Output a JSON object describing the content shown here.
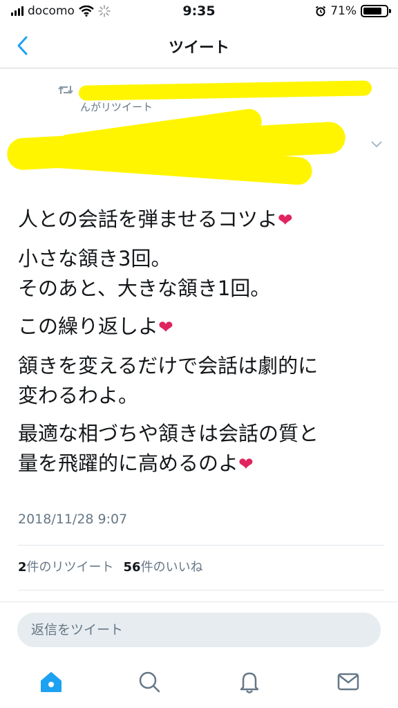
{
  "status_bar": {
    "carrier": "docomo",
    "time": "9:35",
    "battery": "71%"
  },
  "nav": {
    "title": "ツイート"
  },
  "retweet": {
    "label": "んがリツイート"
  },
  "tweet": {
    "paragraphs": [
      {
        "lines": [
          "人との会話を弾ませるコツよ"
        ],
        "heart": true
      },
      {
        "lines": [
          "小さな頷き3回。",
          "そのあと、大きな頷き1回。"
        ],
        "heart": false
      },
      {
        "lines": [
          "この繰り返しよ"
        ],
        "heart": true
      },
      {
        "lines": [
          "頷きを変えるだけで会話は劇的に",
          "変わるわよ。"
        ],
        "heart": false
      },
      {
        "lines": [
          "最適な相づちや頷きは会話の質と",
          "量を飛躍的に高めるのよ"
        ],
        "heart": true
      }
    ],
    "timestamp": "2018/11/28 9:07"
  },
  "stats": {
    "retweets_count": "2",
    "retweets_label": "件のリツイート",
    "likes_count": "56",
    "likes_label": "件のいいね"
  },
  "reply": {
    "placeholder": "返信をツイート"
  },
  "colors": {
    "accent": "#1da1f2",
    "heart": "#e0245e",
    "secondary_text": "#657786",
    "redaction": "#fff500"
  },
  "tabs": [
    "home-icon",
    "search-icon",
    "notifications-icon",
    "messages-icon"
  ]
}
